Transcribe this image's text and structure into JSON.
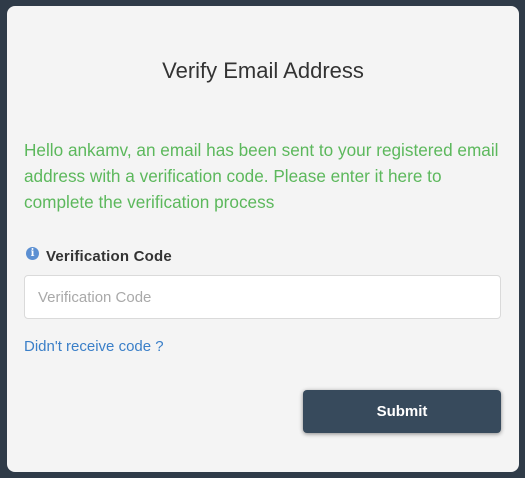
{
  "page": {
    "title": "Verify Email Address",
    "message": "Hello ankamv, an email has been sent to your registered email address with a verification code. Please enter it here to complete the verification process"
  },
  "form": {
    "info_icon": "info-icon",
    "code_label": "Verification Code",
    "code_placeholder": "Verification Code",
    "code_value": "",
    "resend_link": "Didn't receive code ?",
    "submit_label": "Submit"
  },
  "colors": {
    "background": "#2f3b48",
    "card": "#f4f4f4",
    "message_text": "#5cb85c",
    "link": "#3a7fc8",
    "submit_button": "#374a5c"
  }
}
